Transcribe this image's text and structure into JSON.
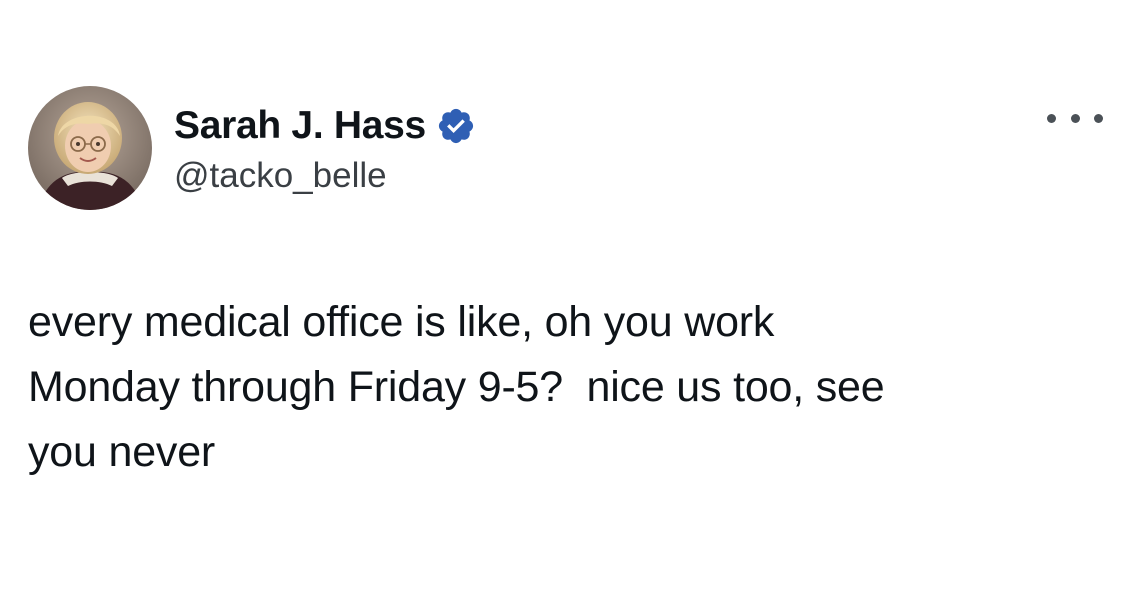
{
  "author": {
    "display_name": "Sarah J. Hass",
    "handle": "@tacko_belle",
    "verified": true,
    "avatar": "child-portrait-photo"
  },
  "icons": {
    "verified": "verified-badge-icon",
    "more": "more-options-icon"
  },
  "colors": {
    "verified_badge": "#2f5fb4",
    "text": "#0f1419",
    "handle": "#3a3f44",
    "background": "#ffffff"
  },
  "tweet": {
    "text": "every medical office is like, oh you work\nMonday through Friday 9-5?  nice us too, see\nyou never"
  }
}
